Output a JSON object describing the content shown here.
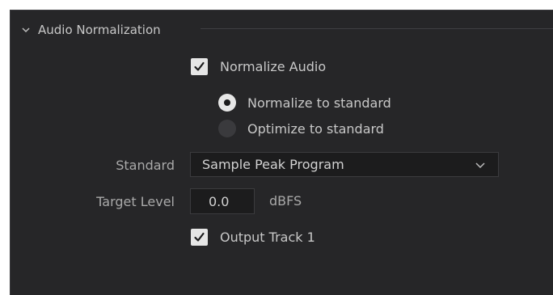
{
  "section": {
    "title": "Audio Normalization",
    "collapse_icon": "chevron-down-icon"
  },
  "normalize_audio": {
    "label": "Normalize Audio",
    "checked": true
  },
  "mode": {
    "options": [
      {
        "label": "Normalize to standard",
        "selected": true
      },
      {
        "label": "Optimize to standard",
        "selected": false
      }
    ]
  },
  "standard": {
    "label": "Standard",
    "value": "Sample Peak Program"
  },
  "target_level": {
    "label": "Target Level",
    "value": "0.0",
    "unit": "dBFS"
  },
  "output_track": {
    "label": "Output Track 1",
    "checked": true
  },
  "colors": {
    "panel_bg": "#262628",
    "input_bg": "#1c1c1d",
    "text": "#c8c8c8",
    "control_light": "#e6e6e6"
  }
}
